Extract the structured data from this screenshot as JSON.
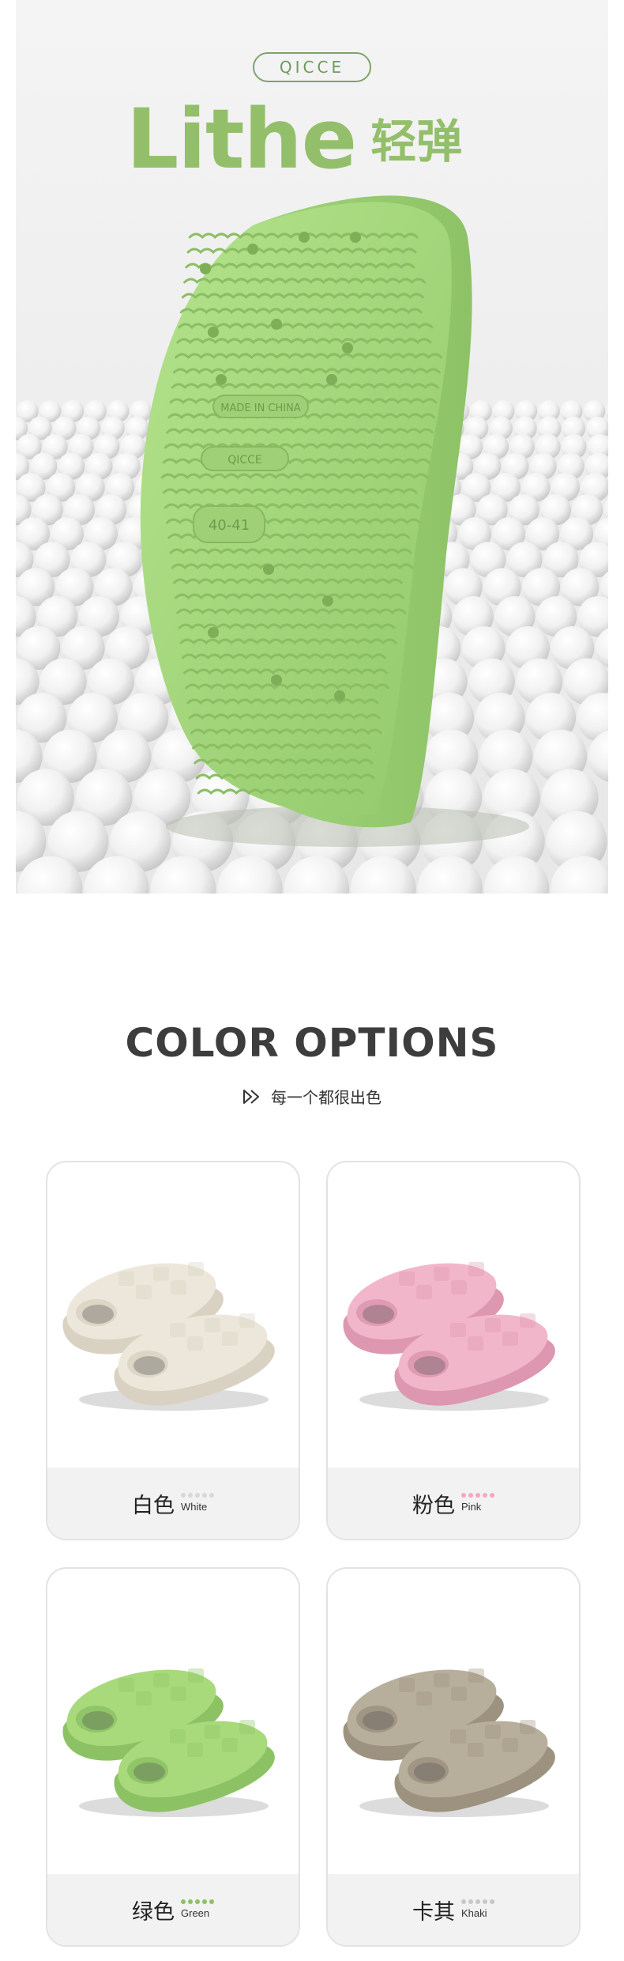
{
  "hero": {
    "brand": "QICCE",
    "title_en": "Lithe",
    "title_cn": "轻弹",
    "sole_texts": [
      "MADE IN CHINA",
      "QICCE",
      "40-41"
    ],
    "accent_color": "#93bf6a",
    "sole_color": "#a6d97e"
  },
  "color_section": {
    "title": "COLOR OPTIONS",
    "subtitle": "每一个都很出色",
    "subtitle_icon": "play-forward-icon"
  },
  "options": [
    {
      "cn": "白色",
      "en": "White",
      "color": "#ece7da",
      "shade": "#d9d2c2",
      "dot_color": "#d8d8d8"
    },
    {
      "cn": "粉色",
      "en": "Pink",
      "color": "#f2b6cb",
      "shade": "#dd97b0",
      "dot_color": "#f4a8c0"
    },
    {
      "cn": "绿色",
      "en": "Green",
      "color": "#a8da7c",
      "shade": "#8cc264",
      "dot_color": "#8cc264"
    },
    {
      "cn": "卡其",
      "en": "Khaki",
      "color": "#b8ae9c",
      "shade": "#9c927f",
      "dot_color": "#c7c7c7"
    }
  ]
}
